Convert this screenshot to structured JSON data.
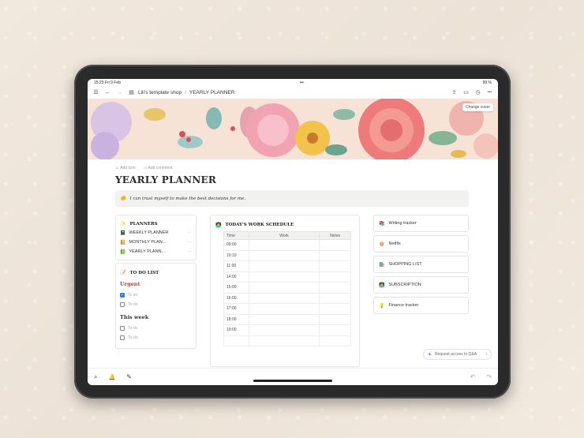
{
  "status": {
    "time": "15:23 Fri 9 Feb",
    "more": "•••",
    "battery": "99 %"
  },
  "topbar": {
    "menu_icon": "☰",
    "back_icon": "←",
    "forward_icon": "→",
    "workspace": "Lili's template shop",
    "separator": "/",
    "page": "YEARLY PLANNER",
    "share_icon": "⇪",
    "comment_icon": "▭",
    "clock_icon": "◷",
    "more_icon": "•••"
  },
  "banner": {
    "change_cover": "Change cover"
  },
  "page_actions": {
    "add_icon": "Add icon",
    "add_comment": "Add comment"
  },
  "title": "YEARLY PLANNER",
  "callout": {
    "icon": "🌼",
    "text": "I can trust myself to make the best decisions for me."
  },
  "planners": {
    "icon": "✨",
    "heading": "PLANNERS",
    "items": [
      {
        "icon": "📓",
        "label": "WEEKLY PLANNER"
      },
      {
        "icon": "📔",
        "label": "MONTHLY PLAN..."
      },
      {
        "icon": "📗",
        "label": "YEARLY PLANN..."
      }
    ],
    "dots": "···"
  },
  "todo": {
    "icon": "📝",
    "heading": "TO DO LIST",
    "urgent_heading": "Urgent",
    "urgent_items": [
      {
        "label": "To do",
        "checked": true
      },
      {
        "label": "To-do",
        "checked": false
      }
    ],
    "week_heading": "This week",
    "week_items": [
      {
        "label": "To-do",
        "checked": false
      },
      {
        "label": "To-do",
        "checked": false
      }
    ],
    "accent": "#c0392b"
  },
  "schedule": {
    "icon": "👩‍💻",
    "heading": "TODAY'S WORK SCHEDULE",
    "columns": [
      "Time",
      "Work",
      "Notes"
    ],
    "rows": [
      "09:00",
      "10:10",
      "11:00",
      "14:00",
      "15:00",
      "16:00",
      "17:00",
      "18:00",
      "19:00",
      ""
    ]
  },
  "trackers": [
    {
      "icon": "📚",
      "label": "Writing tracker"
    },
    {
      "icon": "🍿",
      "label": "Netflix"
    },
    {
      "icon": "🛍️",
      "label": "SHOPPING LIST"
    },
    {
      "icon": "👩‍💻",
      "label": "SUBSCRIPTION"
    },
    {
      "icon": "💡",
      "label": "Finance tracker"
    }
  ],
  "qa": {
    "label": "Request access to Q&A",
    "chevron": "›"
  },
  "bottombar": {
    "search_icon": "⌕",
    "bell_icon": "🔔",
    "edit_icon": "✎",
    "undo_icon": "↶",
    "redo_icon": "↷"
  }
}
